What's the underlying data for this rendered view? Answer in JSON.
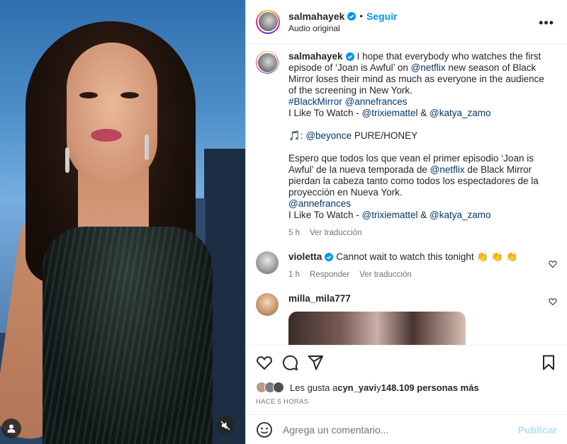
{
  "header": {
    "username": "salmahayek",
    "separator": "•",
    "follow_label": "Seguir",
    "audio": "Audio original",
    "more_icon": "more-horizontal-icon"
  },
  "caption": {
    "username": "salmahayek",
    "line1_text": "I hope that everybody who watches the first episode of ‘Joan is Awful’ on",
    "netflix": "@netflix",
    "line1_rest": "new season of Black Mirror loses their mind as much as everyone in the audience of the screening in New York.",
    "hashtag": "#BlackMirror",
    "annefrances": "@annefrances",
    "song_prefix": "I Like To Watch - ",
    "trixie": "@trixiemattel",
    "amp": " & ",
    "katya": "@katya_zamo",
    "music_note": "🎵: ",
    "beyonce": "@beyonce",
    "pure_honey": " PURE/HONEY",
    "es_part1": "Espero que todos los que vean el primer episodio ‘Joan is Awful’ de la nueva temporada de",
    "es_netflix": "@netflix",
    "es_part2": "de Black Mirror pierdan la cabeza tanto como todos los espectadores de la proyección en Nueva York.",
    "es_annefrances": "@annefrances",
    "es_song_prefix": "I Like To Watch - ",
    "es_trixie": "@trixiemattel",
    "es_amp": " & ",
    "es_katya": "@katya_zamo",
    "time": "5 h",
    "translate": "Ver traducción"
  },
  "comments": [
    {
      "username": "violetta",
      "text": "Cannot wait to watch this tonight 👏 👏 👏",
      "time": "1 h",
      "reply": "Responder",
      "translate": "Ver traducción"
    },
    {
      "username": "milla_mila777"
    }
  ],
  "actions": {
    "like_icon": "heart-icon",
    "comment_icon": "comment-icon",
    "share_icon": "send-icon",
    "save_icon": "bookmark-icon"
  },
  "likes": {
    "prefix": "Les gusta a ",
    "user": "cyn_yavi",
    "mid": " y ",
    "count": "148.109 personas más"
  },
  "timestamp": "HACE 5 HORAS",
  "add_comment": {
    "placeholder": "Agrega un comentario...",
    "post_label": "Publicar"
  },
  "colors": {
    "accent": "#0095f6",
    "link": "#00376b",
    "muted": "#737373",
    "post_disabled": "#b2dffc"
  }
}
